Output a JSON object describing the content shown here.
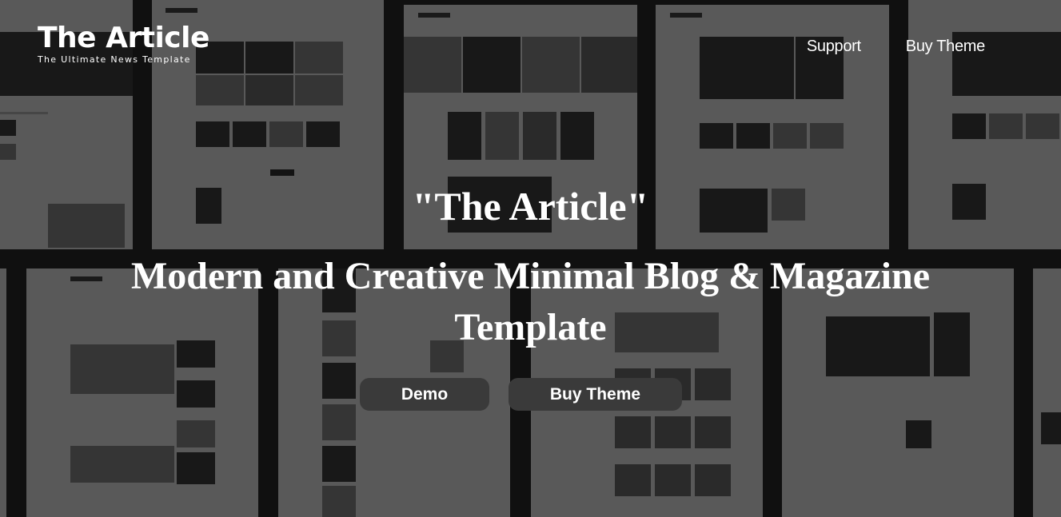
{
  "header": {
    "logo_title": "The Article",
    "logo_subtitle": "The Ultimate News Template",
    "nav": [
      {
        "label": "Support"
      },
      {
        "label": "Buy Theme"
      }
    ]
  },
  "hero": {
    "quote": "\"The Article\"",
    "heading": "Modern and Creative Minimal Blog & Magazine Template",
    "buttons": {
      "demo": "Demo",
      "buy": "Buy Theme"
    }
  },
  "colors": {
    "overlay": "#000000",
    "button_bg": "#3a3a3a",
    "text": "#ffffff"
  }
}
